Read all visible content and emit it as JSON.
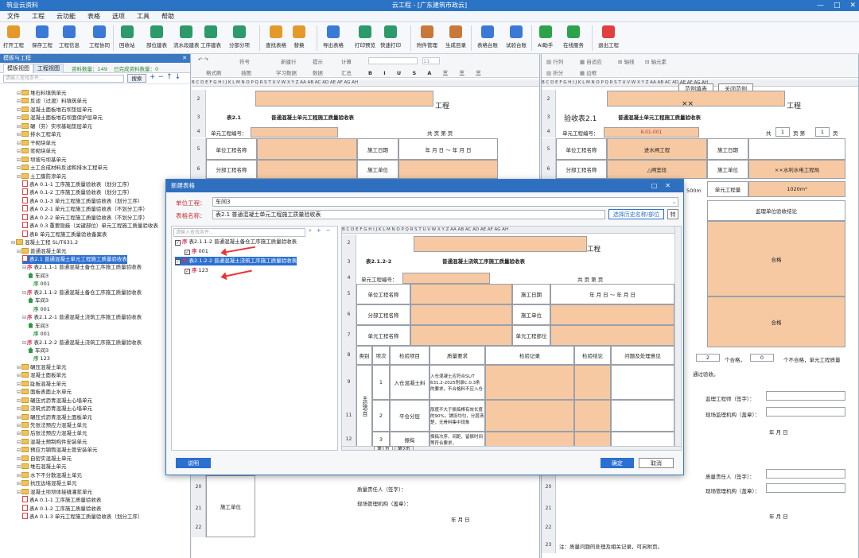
{
  "window": {
    "app_title": "筑业云资料",
    "doc_title": "云工程 - [广东建筑市政云]"
  },
  "menu": [
    "文件",
    "工程",
    "云功能",
    "表格",
    "选项",
    "工具",
    "帮助"
  ],
  "toolbar": [
    {
      "label": "打开工程",
      "color": "#e39a2a"
    },
    {
      "label": "保存工程",
      "color": "#3a7ad6"
    },
    {
      "label": "工程信息",
      "color": "#3a7ad6"
    },
    {
      "label": "工程协同",
      "color": "#3a7ad6"
    },
    {
      "label": "回收站",
      "color": "#2c9a6a"
    },
    {
      "label": "部位建表",
      "color": "#2c9a6a"
    },
    {
      "label": "流水段建表",
      "color": "#2c9a6a"
    },
    {
      "label": "工序建表",
      "color": "#2c9a6a"
    },
    {
      "label": "分部分项",
      "color": "#2c9a6a"
    },
    {
      "label": "查找表格",
      "color": "#e39a2a"
    },
    {
      "label": "替换",
      "color": "#e39a2a"
    },
    {
      "label": "导出表格",
      "color": "#3a7ad6"
    },
    {
      "label": "打印预览",
      "color": "#2c9a6a"
    },
    {
      "label": "快速打印",
      "color": "#2c9a6a"
    },
    {
      "label": "附件管理",
      "color": "#c8783a"
    },
    {
      "label": "生成目录",
      "color": "#c8783a"
    },
    {
      "label": "表格台账",
      "color": "#3a7ad6"
    },
    {
      "label": "试验台账",
      "color": "#3a7ad6"
    },
    {
      "label": "AI助手",
      "color": "#2ca34a"
    },
    {
      "label": "在线服务",
      "color": "#2ca34a"
    },
    {
      "label": "退出工程",
      "color": "#e04040"
    }
  ],
  "left_panel": {
    "title": "模板与工程",
    "tabs": [
      "模板视图",
      "工程视图"
    ],
    "stat1": "资料数量：149",
    "stat2": "已完成资料数量：0",
    "search_placeholder": "请输入查找条件...",
    "search_btn": "搜索",
    "tree": [
      {
        "t": "f",
        "d": 3,
        "text": "堆石料填筑单元"
      },
      {
        "t": "f",
        "d": 3,
        "text": "反滤（过渡）料填筑单元"
      },
      {
        "t": "f",
        "d": 3,
        "text": "混凝土面板堆石坝垫层单元"
      },
      {
        "t": "f",
        "d": 3,
        "text": "混凝土面板堆石坝面保护层单元"
      },
      {
        "t": "f",
        "d": 3,
        "text": "碾（夯）实坝基础垫层单元"
      },
      {
        "t": "f",
        "d": 3,
        "text": "排水工程单元"
      },
      {
        "t": "f",
        "d": 3,
        "text": "干砌块单元"
      },
      {
        "t": "f",
        "d": 3,
        "text": "浆砌块单元"
      },
      {
        "t": "f",
        "d": 3,
        "text": "坝坡与坝基单元"
      },
      {
        "t": "f",
        "d": 3,
        "text": "土工合成材料反滤和排水工程单元"
      },
      {
        "t": "f",
        "d": 3,
        "text": "土工膜防渗单元"
      },
      {
        "t": "d",
        "d": 4,
        "text": "表A 0.1-1 工序施工质量验收表（划分工序）"
      },
      {
        "t": "d",
        "d": 4,
        "text": "表A 0.1-2 工序施工质量验收表（划分工序）"
      },
      {
        "t": "d",
        "d": 4,
        "text": "表A 0.1-3 单元工程施工质量验收表（划分工序）"
      },
      {
        "t": "d",
        "d": 4,
        "text": "表A 0.2-1 单元工程施工质量验收表（不划分工序）"
      },
      {
        "t": "d",
        "d": 4,
        "text": "表A 0.2-2 单元工程施工质量验收表（不划分工序）"
      },
      {
        "t": "d",
        "d": 4,
        "text": "表A 0.3 重要隐蔽（关键部位）单元工程施工质量验收表"
      },
      {
        "t": "d",
        "d": 4,
        "text": "表B 单元工程施工质量验收备案表"
      },
      {
        "t": "f",
        "d": 2,
        "text": "混凝土工程 SL/T631.2"
      },
      {
        "t": "f",
        "d": 3,
        "text": "普通混凝土单元"
      },
      {
        "t": "d",
        "d": 4,
        "text": "表2.1 普通混凝土单元工程施工质量验收表",
        "sel": true
      },
      {
        "t": "s",
        "d": 4,
        "text": "表2.1.1-1 普通混凝土备仓工序施工质量验收表"
      },
      {
        "t": "h",
        "d": 5,
        "text": "车间3"
      },
      {
        "t": "q",
        "d": 6,
        "text": "001"
      },
      {
        "t": "s",
        "d": 4,
        "text": "表2.1.1-2 普通混凝土备仓工序施工质量验收表"
      },
      {
        "t": "h",
        "d": 5,
        "text": "车间3"
      },
      {
        "t": "q",
        "d": 6,
        "text": "001"
      },
      {
        "t": "s",
        "d": 4,
        "text": "表2.1.2-1 普通混凝土浇筑工序施工质量验收表"
      },
      {
        "t": "h",
        "d": 5,
        "text": "车间3"
      },
      {
        "t": "q",
        "d": 6,
        "text": "001"
      },
      {
        "t": "s",
        "d": 4,
        "text": "表2.1.2-2 普通混凝土浇筑工序施工质量验收表"
      },
      {
        "t": "h",
        "d": 5,
        "text": "车间3"
      },
      {
        "t": "q",
        "d": 6,
        "text": "123"
      },
      {
        "t": "f",
        "d": 3,
        "text": "碾压混凝土单元"
      },
      {
        "t": "f",
        "d": 3,
        "text": "混凝土面板单元"
      },
      {
        "t": "f",
        "d": 3,
        "text": "趾板混凝土单元"
      },
      {
        "t": "f",
        "d": 3,
        "text": "面板表面止水单元"
      },
      {
        "t": "f",
        "d": 3,
        "text": "碾压式沥青混凝土心墙单元"
      },
      {
        "t": "f",
        "d": 3,
        "text": "浇筑式沥青混凝土心墙单元"
      },
      {
        "t": "f",
        "d": 3,
        "text": "碾压式沥青混凝土面板单元"
      },
      {
        "t": "f",
        "d": 3,
        "text": "先张法预应力混凝土单元"
      },
      {
        "t": "f",
        "d": 3,
        "text": "后张法预应力混凝土单元"
      },
      {
        "t": "f",
        "d": 3,
        "text": "混凝土预制构件安装单元"
      },
      {
        "t": "f",
        "d": 3,
        "text": "预应力钢筒混凝土管安装单元"
      },
      {
        "t": "f",
        "d": 3,
        "text": "自密实混凝土单元"
      },
      {
        "t": "f",
        "d": 3,
        "text": "堆石混凝土单元"
      },
      {
        "t": "f",
        "d": 3,
        "text": "水下不分散混凝土单元"
      },
      {
        "t": "f",
        "d": 3,
        "text": "抗压边墙混凝土单元"
      },
      {
        "t": "f",
        "d": 3,
        "text": "混凝土坝坝体接缝灌浆单元"
      },
      {
        "t": "d",
        "d": 4,
        "text": "表A 0.1-1 工序施工质量验收表"
      },
      {
        "t": "d",
        "d": 4,
        "text": "表A 0.1-2 工序施工质量验收表"
      },
      {
        "t": "d",
        "d": 4,
        "text": "表A 0.1-3 单元工程施工质量验收表（划分工序）"
      }
    ]
  },
  "editor_left": {
    "t1": "撤销",
    "t2": "格式刷",
    "t3": "符号",
    "t4": "插图",
    "t5": "图片",
    "t6": "新建行",
    "t7": "学习数据",
    "t8": "提示",
    "t9": "数据",
    "t10": "计算",
    "t11": "汇总",
    "col_letters": "B C D E F G H I J K L M N O P Q R S T U V W X Y Z AA AB AC AD AE AF AG AH",
    "title_suffix": "工程",
    "table_title": "表2.1",
    "table_heading": "普通混凝土单元工程施工质量验收表",
    "unit_no": "单元工程编号：",
    "pages": "共          页  第          页",
    "r5a": "单位工程名称",
    "r5b": "施工日期",
    "r5date": "年  月  日    ～    年  月  日",
    "r6a": "分部工程名称",
    "r6b": "施工单位",
    "r20a": "施工单位",
    "r20b": "质量责任人（签字）：",
    "r21": "现场管理机构（盖章）：",
    "r22": "年  月  日"
  },
  "editor_right": {
    "col_letters": "B C D E F G H I J K L M N O P Q R S T U V W X Y Z AA AB AC AD AE AF AG AH",
    "btn1": "范例填表",
    "btn2": "关闭范例",
    "title_prefix": "××",
    "title_suffix": "工程",
    "table_title": "验收表2.1",
    "table_heading": "普通混凝土单元工程施工质量验收表",
    "unit_no": "单元工程编号：",
    "unit_no_val": "K-01-001",
    "pages_a": "共",
    "pages_b": "页  第",
    "pages_c": "页",
    "page_total": "1",
    "page_no": "1",
    "r5a": "单位工程名称",
    "r5v": "进水闸工程",
    "r5b": "施工日期",
    "r6a": "分部工程名称",
    "r6v": "△闸室段",
    "r6b": "施工单位",
    "r6bv": "××水利水电工程局",
    "r7partial": "500m",
    "r7b": "单元工程量",
    "r7bv": "1020m³",
    "r8": "监理单位验收结论",
    "ok1": "合格",
    "ok2": "合格",
    "count_a": "2",
    "count_b": "个合格，",
    "count_c": "0",
    "count_d": "个不合格，单元工程质量",
    "pass_text": "通过验收。",
    "sign1": "监理工程师（签字）：",
    "sign2": "现场监理机构（盖章）：",
    "ymd": "年  月  日",
    "sign3": "质量责任人（签字）：",
    "sign4": "现场管理机构（盖章）：",
    "note": "注：质量问题的处理及相关记录，可另附页。"
  },
  "dialog": {
    "title": "新建表格",
    "unit_label": "单位工程：",
    "unit_value": "车间3",
    "name_label": "表格名称：",
    "name_value": "表2.1 普通混凝土单元工程施工质量验收表",
    "pick_btn": "选择历史名称/部位",
    "special_btn": "特",
    "search_placeholder": "请输入查找条件...",
    "tree": [
      {
        "d": 0,
        "text": "表2.1.1-2 普通混凝土备仓工序施工质量验收表",
        "checked": true
      },
      {
        "d": 1,
        "text": "001",
        "checked": true
      },
      {
        "d": 0,
        "text": "表2.1.2-2 普通混凝土浇筑工序施工质量验收表",
        "checked": true,
        "sel": true
      },
      {
        "d": 1,
        "text": "123",
        "checked": true
      }
    ],
    "preview": {
      "col_letters": "B C D E F G H I J K L M N O P Q R S T U V W X Y Z AA AB AC AD AE AF AG AH",
      "title_suffix": "工程",
      "code": "表2.1.2-2",
      "heading": "普通混凝土浇筑工序施工质量验收表",
      "unit_no": "单元工程编号：",
      "pages": "共          页  第          页",
      "r5a": "单位工程名称",
      "r5b": "施工日期",
      "r5date": "年  月  日    ～    年  月  日",
      "r6a": "分部工程名称",
      "r6b": "施工单位",
      "r7a": "单元工程名称",
      "r7b": "单元工程部位",
      "h1": "类别",
      "h2": "项次",
      "h3": "检验项目",
      "h4": "质量要求",
      "h5": "检验记录",
      "h6": "检验结论",
      "h7": "问题及处理意见",
      "cat": "主控项目",
      "i1n": "1",
      "i1a": "入仓混凝土料",
      "i1b": "入仓混凝土应符合SL/T 631.2-2025附录C.0.3条的要求，不合格料不应入仓",
      "i2n": "2",
      "i2a": "平仓分层",
      "i2b": "厚度不大于振捣棒有效长度的90%，铺设均匀，分层清楚，无骨料集中现象",
      "i3n": "3",
      "i3a": "振捣",
      "i3b": "振捣次序、间距、留振时间等符合要求，",
      "tab1": "第1页",
      "tab2": "第2页"
    },
    "help_btn": "说明",
    "ok_btn": "确定",
    "cancel_btn": "取消"
  }
}
